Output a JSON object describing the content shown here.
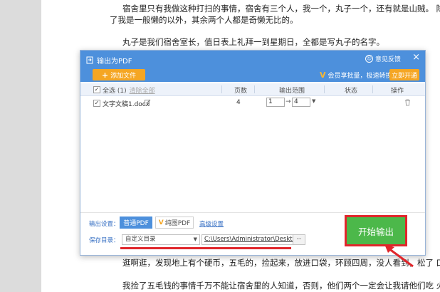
{
  "document": {
    "lines": [
      "宿舍里只有我做这种打扫的事情，宿舍有三个人，我一个，丸子一个，还有就是山贼。   除",
      "了我是一般懒的以外，其余两个人都是奇懒无比的。",
      "丸子是我们宿舍室长，值日表上礼拜一到星期日，全都是写丸子的名字。",
      "逛啊逛，发现地上有个硬币，五毛的，捡起来，放进口袋，环顾四周，没人看到，松了  口气。",
      "我捡了五毛钱的事情千万不能让宿舍里的人知道，否则，他们两个一定会让我请他们吃   火"
    ]
  },
  "dialog": {
    "title": "输出为PDF",
    "feedback": "意见反馈",
    "close": "×",
    "add_file": "添加文件",
    "vip_text": "会员享批量，极速转换",
    "open_vip": "立即开通",
    "table": {
      "headers": {
        "select_all": "全选 (1)",
        "clear_all": "清除全部",
        "pages": "页数",
        "range": "输出范围",
        "status": "状态",
        "action": "操作"
      },
      "rows": [
        {
          "filename": "文字文稿1.docx",
          "pages": "4",
          "range_from": "1",
          "range_to": "4"
        }
      ]
    },
    "output_settings_label": "输出设置：",
    "mode_normal": "普通PDF",
    "mode_pure": "纯图PDF",
    "advanced": "高级设置",
    "save_dir_label": "保存目录：",
    "dir_option": "自定义目录",
    "path": "C:\\Users\\Administrator\\Desktop\\",
    "browse": "···",
    "start": "开始输出"
  },
  "colors": {
    "header_blue": "#4d90dc",
    "accent_orange": "#f5a623",
    "start_green": "#4cb84a",
    "highlight_red": "#e0262b"
  }
}
